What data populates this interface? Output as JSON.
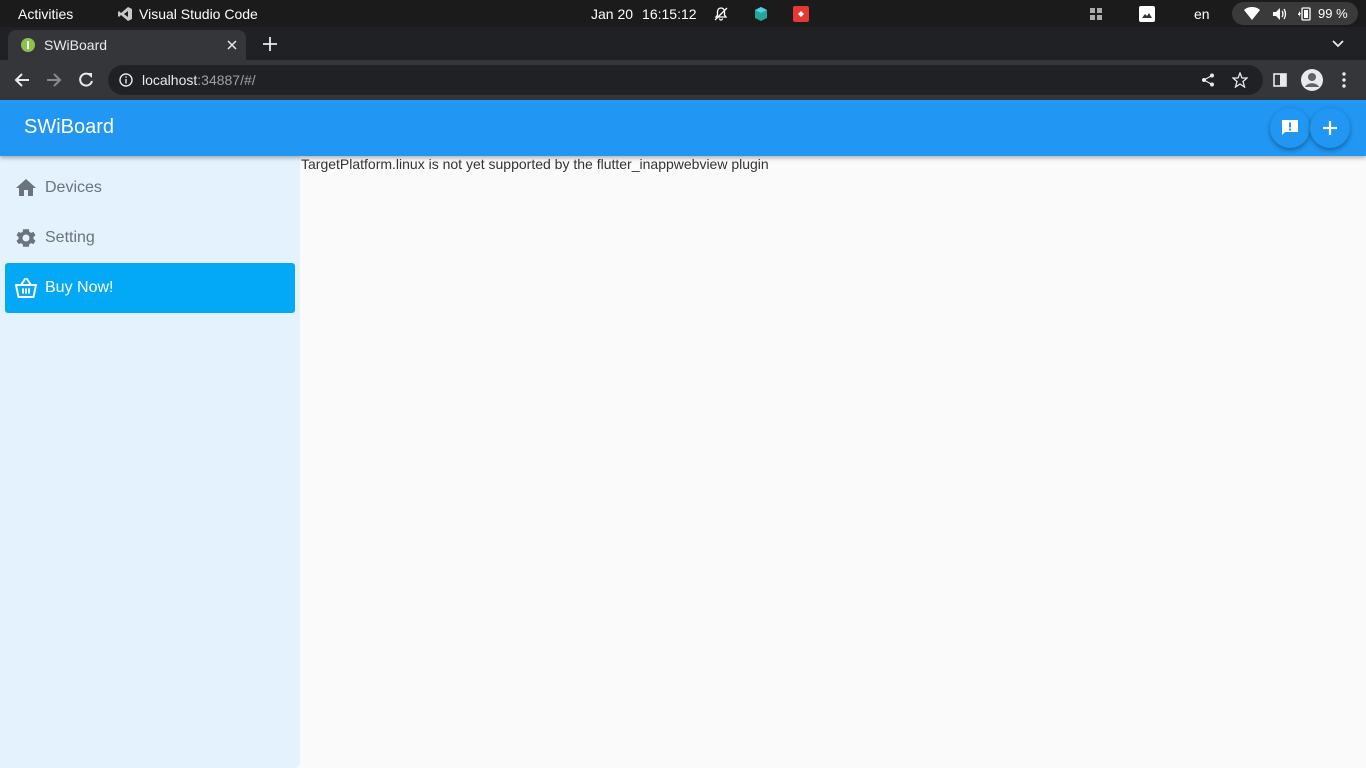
{
  "system_bar": {
    "activities": "Activities",
    "app_name": "Visual Studio Code",
    "date": "Jan 20",
    "time": "16:15:12",
    "language": "en",
    "battery": "99 %"
  },
  "browser": {
    "tab_title": "SWiBoard",
    "url_host": "localhost",
    "url_rest": ":34887/#/"
  },
  "app": {
    "title": "SWiBoard",
    "nav": [
      {
        "label": "Devices",
        "icon": "home-icon"
      },
      {
        "label": "Setting",
        "icon": "gear-icon"
      },
      {
        "label": "Buy Now!",
        "icon": "basket-icon",
        "active": true
      }
    ],
    "message": "TargetPlatform.linux is not yet supported by the flutter_inappwebview plugin"
  },
  "colors": {
    "app_bar": "#2196f3",
    "sidebar_bg": "#e3f2fd",
    "active_item": "#03a9f4"
  }
}
